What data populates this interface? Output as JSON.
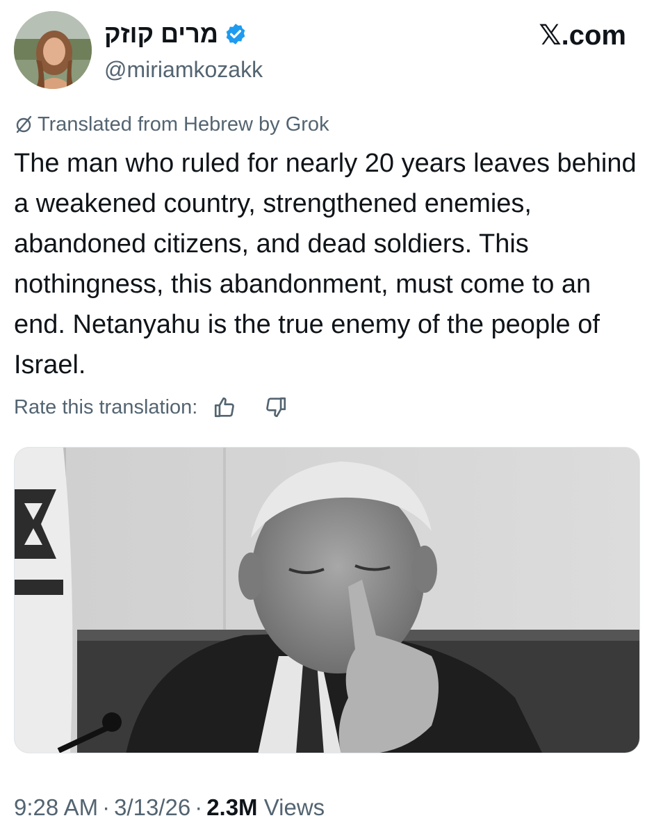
{
  "tweet": {
    "author": {
      "display_name": "מרים קוזק",
      "handle": "@miriamkozakk",
      "verified": true
    },
    "site_label": "𝕏.com",
    "translation_notice": "Translated from Hebrew by Grok",
    "text": "The man who ruled for nearly 20 years leaves behind a weakened country, strengthened enemies, abandoned citizens, and dead soldiers. This nothingness, this abandonment, must come to an end. Netanyahu is the true enemy of the people of Israel.",
    "rate_prompt": "Rate this translation:",
    "meta": {
      "time": "9:28 AM",
      "separator": "·",
      "date": "3/13/26",
      "views_count": "2.3M",
      "views_label": "Views"
    },
    "colors": {
      "text": "#0f1419",
      "secondary": "#536471",
      "verified": "#1d9bf0"
    }
  }
}
